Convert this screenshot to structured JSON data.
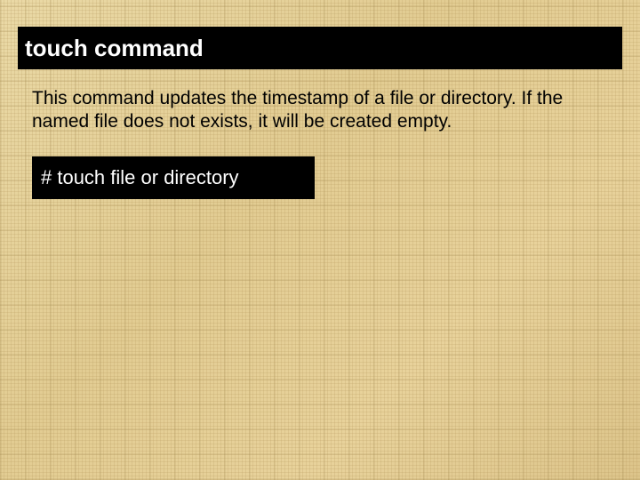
{
  "title": "touch command",
  "description": "This command updates the timestamp of a file or directory. If the named file does not exists, it will be created empty.",
  "code": "# touch  file or directory"
}
